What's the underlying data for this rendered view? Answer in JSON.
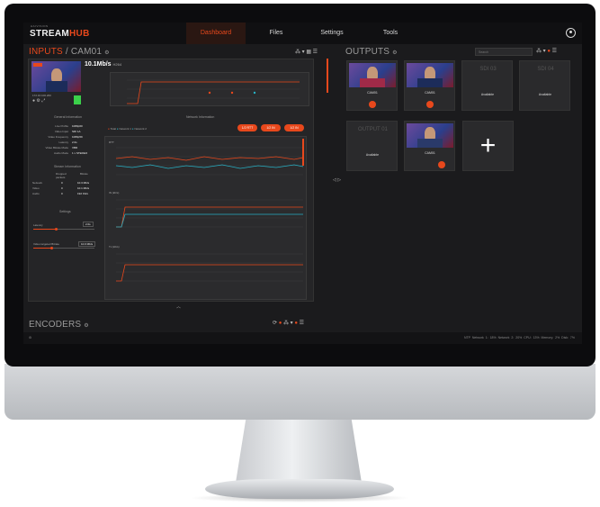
{
  "app": {
    "logo_prefix": "HAIVISION",
    "logo_main": "STREAM",
    "logo_accent": "HUB"
  },
  "nav": {
    "dashboard": "Dashboard",
    "files": "Files",
    "settings": "Settings",
    "tools": "Tools"
  },
  "inputs": {
    "title_prefix": "INPUTS",
    "title_name": "/ CAM01",
    "bitrate": "10.1Mb/s",
    "bitrate_unit": "H264",
    "ip": "172.16.100.200",
    "general_title": "General Information",
    "general": [
      {
        "label": "Live Profile",
        "value": "1080p60"
      },
      {
        "label": "Video Input",
        "value": "SDI 1A"
      },
      {
        "label": "Video Frequency",
        "value": "1080p59"
      },
      {
        "label": "Latency",
        "value": "2.0s"
      },
      {
        "label": "Video Bitrate Mode",
        "value": "VBR"
      },
      {
        "label": "Audio Mode",
        "value": "1 x STEREO"
      }
    ],
    "stream_title": "Stream Information",
    "stream_head": [
      "Dropped packets",
      "Bitrate"
    ],
    "stream_rows": [
      {
        "label": "Network",
        "dropped": "0",
        "bitrate": "10.3 Mb/s"
      },
      {
        "label": "Video",
        "dropped": "0",
        "bitrate": "10.1 Mb/s"
      },
      {
        "label": "Audio",
        "dropped": "0",
        "bitrate": "192 Kb/s"
      }
    ],
    "settings_title": "Settings",
    "latency_label": "Latency",
    "latency_value": "2.0s",
    "bitrate_label": "Video targeted Bitrate",
    "bitrate_value": "10.0 Mb/s",
    "network_title": "Network Information",
    "net_buttons": [
      "1/2 RTT",
      "1/2 IN",
      "1/2 IN"
    ],
    "rtt_label": "RTT",
    "in_label": "IN (kb/s)",
    "out_label": "Tx (kb/s)",
    "legend": [
      "Total",
      "Network 1",
      "Network 2"
    ]
  },
  "outputs": {
    "title": "OUTPUTS",
    "search_placeholder": "Search",
    "tiles": [
      {
        "name": "CAM01",
        "status": ""
      },
      {
        "name": "CAM01",
        "status": ""
      },
      {
        "name": "Available",
        "placeholder": "SDI 03"
      },
      {
        "name": "Available",
        "placeholder": "SDI 04"
      },
      {
        "name": "Available",
        "placeholder": "OUTPUT 01"
      },
      {
        "name": "CAM01",
        "status": ""
      }
    ]
  },
  "encoders": {
    "title": "ENCODERS"
  },
  "statusbar": {
    "items": [
      "NTP",
      "Network 1: 18%",
      "Network 2: 20%",
      "CPU: 13%",
      "Memory: 2%",
      "Disk: 7%"
    ]
  },
  "colors": {
    "accent": "#e8481c",
    "bg": "#1b1b1d"
  }
}
